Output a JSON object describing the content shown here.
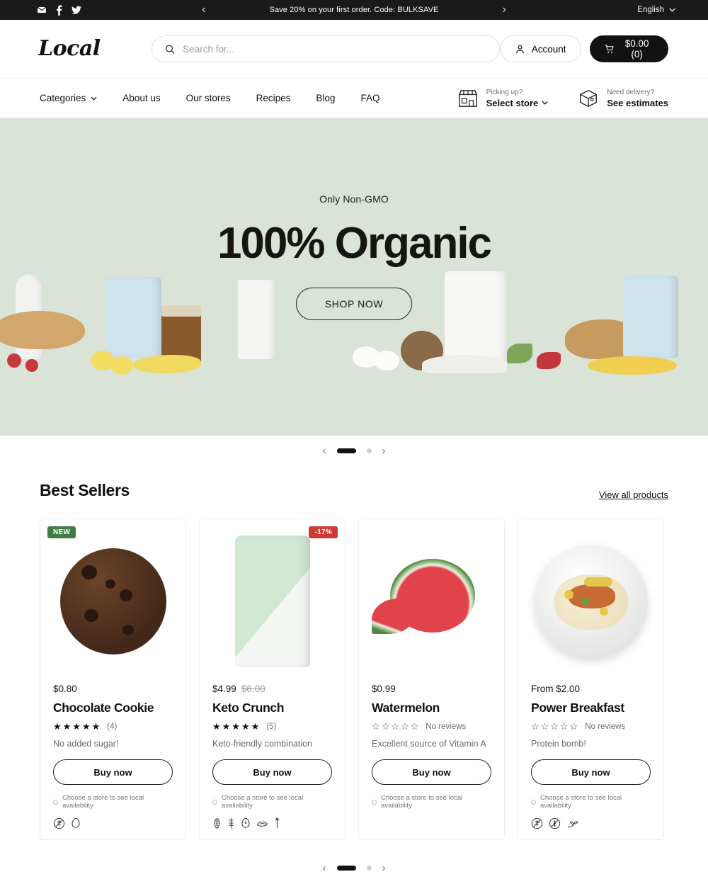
{
  "topbar": {
    "social": [
      {
        "name": "email-icon",
        "label": "Email"
      },
      {
        "name": "facebook-icon",
        "label": "Facebook"
      },
      {
        "name": "twitter-icon",
        "label": "Twitter"
      }
    ],
    "promo_text": "Save 20% on your first order. Code: BULKSAVE",
    "prev_arrow": "‹",
    "next_arrow": "›",
    "language": "English",
    "language_caret": "⌄",
    "background": "#1a1a1a"
  },
  "header": {
    "logo": "Local",
    "search_placeholder": "Search for...",
    "search_value": "",
    "account_label": "Account",
    "cart_label": "$0.00 (0)",
    "cart_background": "#121212"
  },
  "nav": {
    "links": [
      {
        "label": "Categories",
        "has_caret": true
      },
      {
        "label": "About us",
        "has_caret": false
      },
      {
        "label": "Our stores",
        "has_caret": false
      },
      {
        "label": "Recipes",
        "has_caret": false
      },
      {
        "label": "Blog",
        "has_caret": false
      },
      {
        "label": "FAQ",
        "has_caret": false
      }
    ],
    "services": [
      {
        "icon": "store-icon",
        "top": "Picking up?",
        "main": "Select store",
        "caret": true
      },
      {
        "icon": "box-icon",
        "top": "Need delivery?",
        "main": "See estimates",
        "caret": false
      }
    ]
  },
  "hero": {
    "kicker": "Only Non-GMO",
    "title": "100% Organic",
    "cta": "SHOP NOW",
    "background": "#d9e3d7",
    "carousel": {
      "prev": "‹",
      "next": "›",
      "slides": 2,
      "active": 1
    }
  },
  "best_sellers": {
    "title": "Best Sellers",
    "view_all": "View all products",
    "availability_note": "Choose a store to see local availability",
    "buy_label": "Buy now",
    "carousel": {
      "prev": "‹",
      "next": "›",
      "slides": 2,
      "active": 1
    },
    "products": [
      {
        "name": "Chocolate Cookie",
        "price": "$0.80",
        "price_old": "",
        "badge": {
          "text": "NEW",
          "type": "new",
          "color": "#3f7d46"
        },
        "stars_filled": 5,
        "review_count": "(4)",
        "description": "No added sugar!",
        "diet_icons": [
          "no-sugar-icon",
          "egg-icon"
        ]
      },
      {
        "name": "Keto Crunch",
        "price": "$4.99",
        "price_old": "$6.00",
        "badge": {
          "text": "-17%",
          "type": "sale",
          "color": "#cf3a35"
        },
        "stars_filled": 5,
        "review_count": "(5)",
        "description": "Keto-friendly combination",
        "diet_icons": [
          "corn-icon",
          "wheat-icon",
          "egg-icon",
          "peanut-icon",
          "soy-icon"
        ]
      },
      {
        "name": "Watermelon",
        "price": "$0.99",
        "price_old": "",
        "badge": null,
        "stars_filled": 0,
        "review_count": "No reviews",
        "description": "Excellent source of Vitamin A",
        "diet_icons": []
      },
      {
        "name": "Power Breakfast",
        "price": "From $2.00",
        "price_old": "",
        "badge": null,
        "stars_filled": 0,
        "review_count": "No reviews",
        "description": "Protein bomb!",
        "diet_icons": [
          "no-sugar-icon",
          "no-gluten-icon",
          "vegan-leaf-icon"
        ]
      }
    ]
  }
}
